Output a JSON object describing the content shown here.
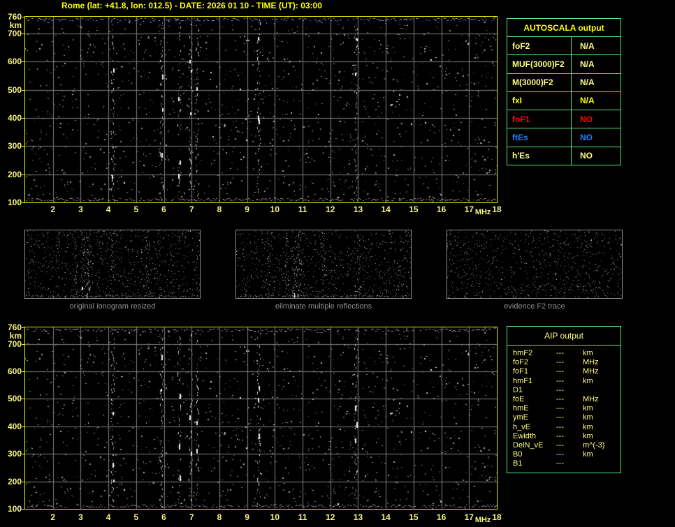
{
  "title": "Rome (lat: +41.8, lon: 012.5) - DATE: 2026 01 10 - TIME (UT): 03:00",
  "colors": {
    "background": "#000000",
    "title": "#FFFF00",
    "plot_border": "#F0F000",
    "axis_label": "#F5F57D",
    "grid": "#7F7F7F",
    "table_border": "#55E87F",
    "pale_yellow": "#FFFF80",
    "bright_yellow": "#FFFF00",
    "red": "#FF0000",
    "blue": "#1E7FFF",
    "caption_gray": "#8F8F8F"
  },
  "chart_data": [
    {
      "type": "scatter",
      "name": "main ionogram (top)",
      "xlabel": "MHz",
      "ylabel": "km",
      "x_range": [
        1,
        18
      ],
      "y_range": [
        100,
        760
      ],
      "x_ticks": [
        2,
        3,
        4,
        5,
        6,
        7,
        8,
        9,
        10,
        11,
        12,
        13,
        14,
        15,
        16,
        17,
        18
      ],
      "y_ticks": [
        760,
        700,
        600,
        500,
        400,
        300,
        200,
        100
      ],
      "grid": true,
      "content": "random noise speckle only; no echo trace identified",
      "noise_streak_freqs_mhz": [
        4.15,
        5.9,
        6.55,
        6.95,
        7.2,
        9.4,
        12.9
      ]
    },
    {
      "type": "scatter",
      "name": "AIP ionogram (bottom)",
      "xlabel": "MHz",
      "ylabel": "km",
      "x_range": [
        1,
        18
      ],
      "y_range": [
        100,
        760
      ],
      "x_ticks": [
        2,
        3,
        4,
        5,
        6,
        7,
        8,
        9,
        10,
        11,
        12,
        13,
        14,
        15,
        16,
        17,
        18
      ],
      "y_ticks": [
        760,
        700,
        600,
        500,
        400,
        300,
        200,
        100
      ],
      "grid": true,
      "content": "random noise speckle only; no echo trace identified",
      "noise_streak_freqs_mhz": [
        4.15,
        5.9,
        6.55,
        6.95,
        7.2,
        9.4,
        12.9
      ]
    }
  ],
  "autoscala_table": {
    "header": "AUTOSCALA output",
    "rows": [
      {
        "label": "foF2",
        "value": "N/A",
        "color": "#FFFF80"
      },
      {
        "label": "MUF(3000)F2",
        "value": "N/A",
        "color": "#FFFF80"
      },
      {
        "label": "M(3000)F2",
        "value": "N/A",
        "color": "#FFFF80"
      },
      {
        "label": "fxI",
        "value": "N/A",
        "color": "#FFFF00"
      },
      {
        "label": "foF1",
        "value": "NO",
        "color": "#FF0000"
      },
      {
        "label": "ftEs",
        "value": "NO",
        "color": "#1E7FFF"
      },
      {
        "label": "h'Es",
        "value": "NO",
        "color": "#FFFF80"
      }
    ]
  },
  "aip_table": {
    "header": "AIP output",
    "rows": [
      {
        "label": "hmF2",
        "value": "---",
        "unit": "km"
      },
      {
        "label": "foF2",
        "value": "---",
        "unit": "MHz"
      },
      {
        "label": "foF1",
        "value": "---",
        "unit": "MHz"
      },
      {
        "label": "hmF1",
        "value": "---",
        "unit": "km"
      },
      {
        "label": "D1",
        "value": "---",
        "unit": ""
      },
      {
        "label": "foE",
        "value": "---",
        "unit": "MHz"
      },
      {
        "label": "hmE",
        "value": "---",
        "unit": "km"
      },
      {
        "label": "ymE",
        "value": "---",
        "unit": "km"
      },
      {
        "label": "h_vE",
        "value": "---",
        "unit": "km"
      },
      {
        "label": "Ewidth",
        "value": "---",
        "unit": "km"
      },
      {
        "label": "DelN_vE",
        "value": "---",
        "unit": "m^(-3)"
      },
      {
        "label": "B0",
        "value": "---",
        "unit": "km"
      },
      {
        "label": "B1",
        "value": "---",
        "unit": ""
      }
    ]
  },
  "thumbnails": [
    {
      "caption": "original ionogram resized"
    },
    {
      "caption": "eliminate multiple reflections"
    },
    {
      "caption": "evidence F2 trace"
    }
  ]
}
